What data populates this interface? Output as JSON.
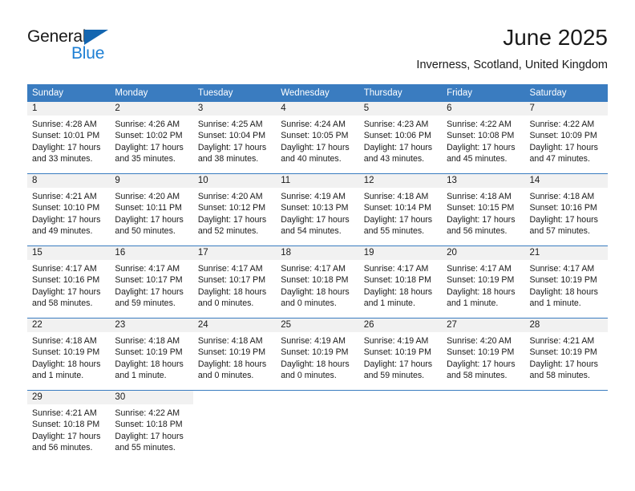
{
  "logo": {
    "word_one": "General",
    "word_two": "Blue",
    "triangle_color": "#1466b0",
    "blue_color": "#1d7fd4"
  },
  "header": {
    "month_title": "June 2025",
    "location": "Inverness, Scotland, United Kingdom"
  },
  "theme": {
    "header_bg": "#3a7cc0",
    "header_text": "#ffffff",
    "daynum_band_bg": "#f1f1f1",
    "row_divider": "#3a7cc0",
    "body_text": "#1a1a1a"
  },
  "weekday_headers": [
    "Sunday",
    "Monday",
    "Tuesday",
    "Wednesday",
    "Thursday",
    "Friday",
    "Saturday"
  ],
  "labels": {
    "sunrise_prefix": "Sunrise:",
    "sunset_prefix": "Sunset:",
    "daylight_prefix": "Daylight:"
  },
  "weeks": [
    [
      {
        "day": "1",
        "sunrise": "Sunrise: 4:28 AM",
        "sunset": "Sunset: 10:01 PM",
        "daylight_line1": "Daylight: 17 hours",
        "daylight_line2": "and 33 minutes."
      },
      {
        "day": "2",
        "sunrise": "Sunrise: 4:26 AM",
        "sunset": "Sunset: 10:02 PM",
        "daylight_line1": "Daylight: 17 hours",
        "daylight_line2": "and 35 minutes."
      },
      {
        "day": "3",
        "sunrise": "Sunrise: 4:25 AM",
        "sunset": "Sunset: 10:04 PM",
        "daylight_line1": "Daylight: 17 hours",
        "daylight_line2": "and 38 minutes."
      },
      {
        "day": "4",
        "sunrise": "Sunrise: 4:24 AM",
        "sunset": "Sunset: 10:05 PM",
        "daylight_line1": "Daylight: 17 hours",
        "daylight_line2": "and 40 minutes."
      },
      {
        "day": "5",
        "sunrise": "Sunrise: 4:23 AM",
        "sunset": "Sunset: 10:06 PM",
        "daylight_line1": "Daylight: 17 hours",
        "daylight_line2": "and 43 minutes."
      },
      {
        "day": "6",
        "sunrise": "Sunrise: 4:22 AM",
        "sunset": "Sunset: 10:08 PM",
        "daylight_line1": "Daylight: 17 hours",
        "daylight_line2": "and 45 minutes."
      },
      {
        "day": "7",
        "sunrise": "Sunrise: 4:22 AM",
        "sunset": "Sunset: 10:09 PM",
        "daylight_line1": "Daylight: 17 hours",
        "daylight_line2": "and 47 minutes."
      }
    ],
    [
      {
        "day": "8",
        "sunrise": "Sunrise: 4:21 AM",
        "sunset": "Sunset: 10:10 PM",
        "daylight_line1": "Daylight: 17 hours",
        "daylight_line2": "and 49 minutes."
      },
      {
        "day": "9",
        "sunrise": "Sunrise: 4:20 AM",
        "sunset": "Sunset: 10:11 PM",
        "daylight_line1": "Daylight: 17 hours",
        "daylight_line2": "and 50 minutes."
      },
      {
        "day": "10",
        "sunrise": "Sunrise: 4:20 AM",
        "sunset": "Sunset: 10:12 PM",
        "daylight_line1": "Daylight: 17 hours",
        "daylight_line2": "and 52 minutes."
      },
      {
        "day": "11",
        "sunrise": "Sunrise: 4:19 AM",
        "sunset": "Sunset: 10:13 PM",
        "daylight_line1": "Daylight: 17 hours",
        "daylight_line2": "and 54 minutes."
      },
      {
        "day": "12",
        "sunrise": "Sunrise: 4:18 AM",
        "sunset": "Sunset: 10:14 PM",
        "daylight_line1": "Daylight: 17 hours",
        "daylight_line2": "and 55 minutes."
      },
      {
        "day": "13",
        "sunrise": "Sunrise: 4:18 AM",
        "sunset": "Sunset: 10:15 PM",
        "daylight_line1": "Daylight: 17 hours",
        "daylight_line2": "and 56 minutes."
      },
      {
        "day": "14",
        "sunrise": "Sunrise: 4:18 AM",
        "sunset": "Sunset: 10:16 PM",
        "daylight_line1": "Daylight: 17 hours",
        "daylight_line2": "and 57 minutes."
      }
    ],
    [
      {
        "day": "15",
        "sunrise": "Sunrise: 4:17 AM",
        "sunset": "Sunset: 10:16 PM",
        "daylight_line1": "Daylight: 17 hours",
        "daylight_line2": "and 58 minutes."
      },
      {
        "day": "16",
        "sunrise": "Sunrise: 4:17 AM",
        "sunset": "Sunset: 10:17 PM",
        "daylight_line1": "Daylight: 17 hours",
        "daylight_line2": "and 59 minutes."
      },
      {
        "day": "17",
        "sunrise": "Sunrise: 4:17 AM",
        "sunset": "Sunset: 10:17 PM",
        "daylight_line1": "Daylight: 18 hours",
        "daylight_line2": "and 0 minutes."
      },
      {
        "day": "18",
        "sunrise": "Sunrise: 4:17 AM",
        "sunset": "Sunset: 10:18 PM",
        "daylight_line1": "Daylight: 18 hours",
        "daylight_line2": "and 0 minutes."
      },
      {
        "day": "19",
        "sunrise": "Sunrise: 4:17 AM",
        "sunset": "Sunset: 10:18 PM",
        "daylight_line1": "Daylight: 18 hours",
        "daylight_line2": "and 1 minute."
      },
      {
        "day": "20",
        "sunrise": "Sunrise: 4:17 AM",
        "sunset": "Sunset: 10:19 PM",
        "daylight_line1": "Daylight: 18 hours",
        "daylight_line2": "and 1 minute."
      },
      {
        "day": "21",
        "sunrise": "Sunrise: 4:17 AM",
        "sunset": "Sunset: 10:19 PM",
        "daylight_line1": "Daylight: 18 hours",
        "daylight_line2": "and 1 minute."
      }
    ],
    [
      {
        "day": "22",
        "sunrise": "Sunrise: 4:18 AM",
        "sunset": "Sunset: 10:19 PM",
        "daylight_line1": "Daylight: 18 hours",
        "daylight_line2": "and 1 minute."
      },
      {
        "day": "23",
        "sunrise": "Sunrise: 4:18 AM",
        "sunset": "Sunset: 10:19 PM",
        "daylight_line1": "Daylight: 18 hours",
        "daylight_line2": "and 1 minute."
      },
      {
        "day": "24",
        "sunrise": "Sunrise: 4:18 AM",
        "sunset": "Sunset: 10:19 PM",
        "daylight_line1": "Daylight: 18 hours",
        "daylight_line2": "and 0 minutes."
      },
      {
        "day": "25",
        "sunrise": "Sunrise: 4:19 AM",
        "sunset": "Sunset: 10:19 PM",
        "daylight_line1": "Daylight: 18 hours",
        "daylight_line2": "and 0 minutes."
      },
      {
        "day": "26",
        "sunrise": "Sunrise: 4:19 AM",
        "sunset": "Sunset: 10:19 PM",
        "daylight_line1": "Daylight: 17 hours",
        "daylight_line2": "and 59 minutes."
      },
      {
        "day": "27",
        "sunrise": "Sunrise: 4:20 AM",
        "sunset": "Sunset: 10:19 PM",
        "daylight_line1": "Daylight: 17 hours",
        "daylight_line2": "and 58 minutes."
      },
      {
        "day": "28",
        "sunrise": "Sunrise: 4:21 AM",
        "sunset": "Sunset: 10:19 PM",
        "daylight_line1": "Daylight: 17 hours",
        "daylight_line2": "and 58 minutes."
      }
    ],
    [
      {
        "day": "29",
        "sunrise": "Sunrise: 4:21 AM",
        "sunset": "Sunset: 10:18 PM",
        "daylight_line1": "Daylight: 17 hours",
        "daylight_line2": "and 56 minutes."
      },
      {
        "day": "30",
        "sunrise": "Sunrise: 4:22 AM",
        "sunset": "Sunset: 10:18 PM",
        "daylight_line1": "Daylight: 17 hours",
        "daylight_line2": "and 55 minutes."
      },
      {
        "day": "",
        "sunrise": "",
        "sunset": "",
        "daylight_line1": "",
        "daylight_line2": ""
      },
      {
        "day": "",
        "sunrise": "",
        "sunset": "",
        "daylight_line1": "",
        "daylight_line2": ""
      },
      {
        "day": "",
        "sunrise": "",
        "sunset": "",
        "daylight_line1": "",
        "daylight_line2": ""
      },
      {
        "day": "",
        "sunrise": "",
        "sunset": "",
        "daylight_line1": "",
        "daylight_line2": ""
      },
      {
        "day": "",
        "sunrise": "",
        "sunset": "",
        "daylight_line1": "",
        "daylight_line2": ""
      }
    ]
  ]
}
